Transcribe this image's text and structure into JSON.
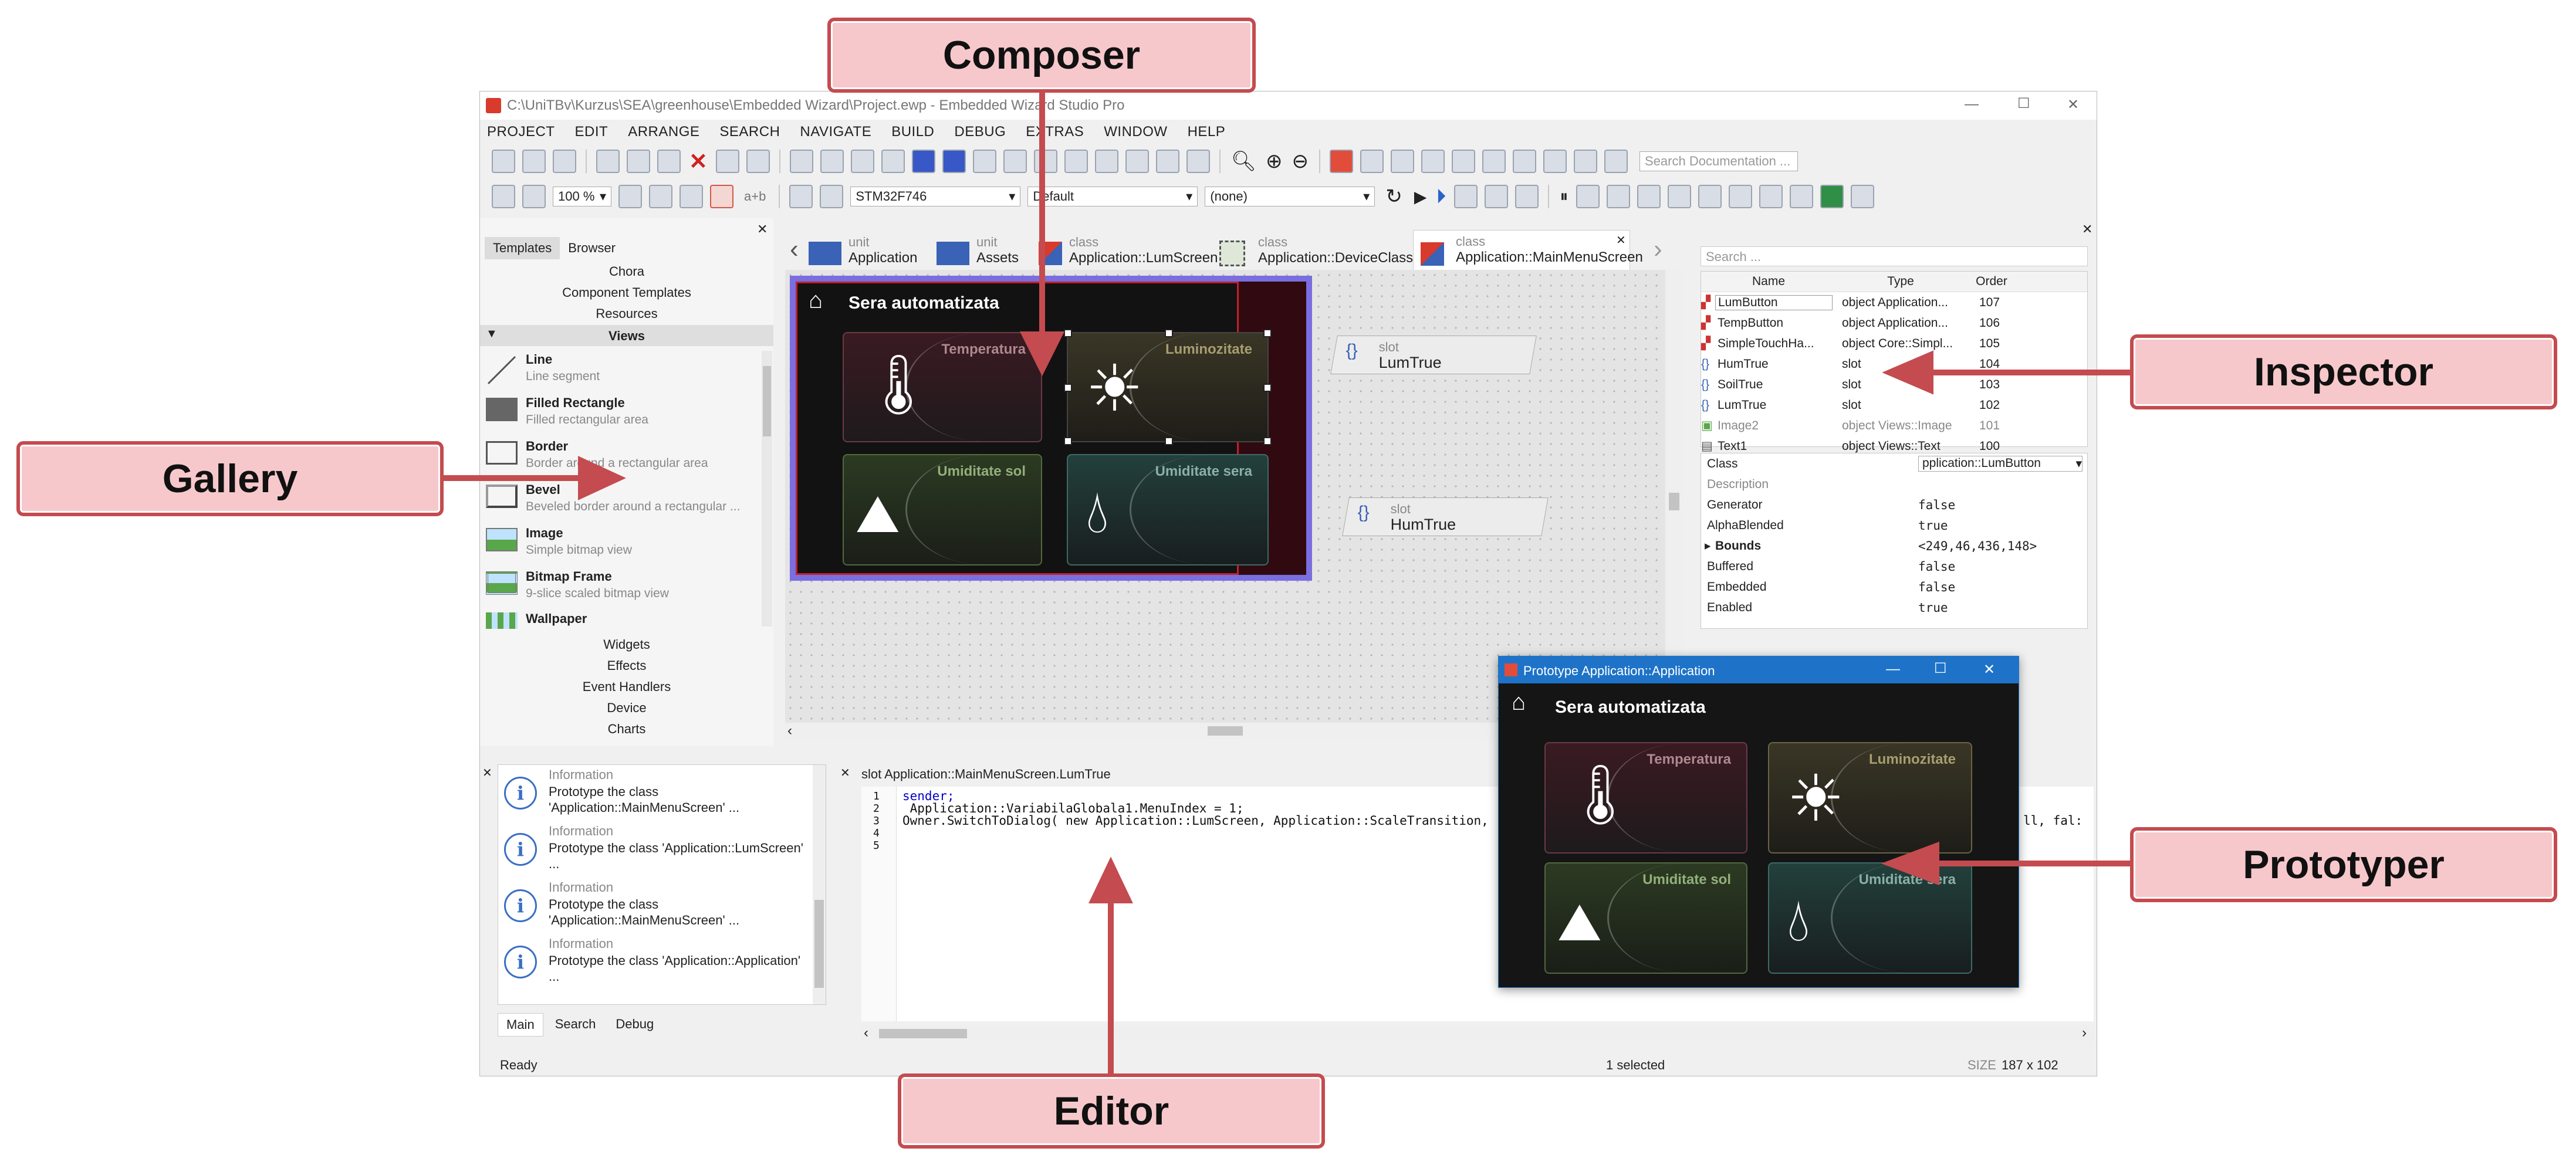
{
  "window": {
    "title": "C:\\UniTBv\\Kurzus\\SEA\\greenhouse\\Embedded Wizard\\Project.ewp - Embedded Wizard Studio Pro",
    "controls": {
      "min": "—",
      "max": "☐",
      "close": "✕"
    }
  },
  "menu": [
    "PROJECT",
    "EDIT",
    "ARRANGE",
    "SEARCH",
    "NAVIGATE",
    "BUILD",
    "DEBUG",
    "EXTRAS",
    "WINDOW",
    "HELP"
  ],
  "toolbar": {
    "search_placeholder": "Search Documentation ...",
    "zoom": "100 %",
    "ab_label": "a+b",
    "platform": "STM32F746",
    "profile": "Default",
    "variant": "(none)"
  },
  "browser_tabs": [
    {
      "kind": "unit",
      "name": "Application",
      "icon": "folder-icon"
    },
    {
      "kind": "unit",
      "name": "Assets",
      "icon": "folder-icon"
    },
    {
      "kind": "class",
      "name": "Application::LumScreen",
      "icon": "class-icon"
    },
    {
      "kind": "class",
      "name": "Application::DeviceClass",
      "icon": "device-class-icon"
    },
    {
      "kind": "class",
      "name": "Application::MainMenuScreen",
      "icon": "class-icon"
    }
  ],
  "gallery": {
    "tabs": [
      "Templates",
      "Browser"
    ],
    "folders_top": [
      "Chora",
      "Component Templates",
      "Resources"
    ],
    "open_folder": "Views",
    "items": [
      {
        "title": "Line",
        "desc": "Line segment",
        "icon": "line-icon"
      },
      {
        "title": "Filled Rectangle",
        "desc": "Filled rectangular area",
        "icon": "filled-rectangle-icon"
      },
      {
        "title": "Border",
        "desc": "Border around a rectangular area",
        "icon": "border-icon"
      },
      {
        "title": "Bevel",
        "desc": "Beveled border around a rectangular ...",
        "icon": "bevel-icon"
      },
      {
        "title": "Image",
        "desc": "Simple bitmap view",
        "icon": "image-icon"
      },
      {
        "title": "Bitmap Frame",
        "desc": "9-slice scaled bitmap view",
        "icon": "bitmap-frame-icon"
      },
      {
        "title": "Wallpaper",
        "desc": "",
        "icon": "wallpaper-icon"
      }
    ],
    "folders_bottom": [
      "Widgets",
      "Effects",
      "Event Handlers",
      "Device",
      "Charts"
    ]
  },
  "composer": {
    "screen_title": "Sera automatizata",
    "tiles": [
      "Temperatura",
      "Luminozitate",
      "Umiditate sol",
      "Umiditate sera"
    ],
    "slots": [
      {
        "kind": "slot",
        "name": "LumTrue"
      },
      {
        "kind": "slot",
        "name": "HumTrue"
      }
    ]
  },
  "inspector": {
    "search_placeholder": "Search ...",
    "columns": [
      "Name",
      "Type",
      "Order"
    ],
    "members": [
      {
        "name": "LumButton",
        "type": "object Application...",
        "order": "107"
      },
      {
        "name": "TempButton",
        "type": "object Application...",
        "order": "106"
      },
      {
        "name": "SimpleTouchHa...",
        "type": "object Core::Simpl...",
        "order": "105"
      },
      {
        "name": "HumTrue",
        "type": "slot",
        "order": "104"
      },
      {
        "name": "SoilTrue",
        "type": "slot",
        "order": "103"
      },
      {
        "name": "LumTrue",
        "type": "slot",
        "order": "102"
      },
      {
        "name": "Image2",
        "type": "object Views::Image",
        "order": "101"
      },
      {
        "name": "Text1",
        "type": "object Views::Text",
        "order": "100"
      }
    ],
    "properties": [
      {
        "name": "Class",
        "value": "pplication::LumButton"
      },
      {
        "name": "Description",
        "value": ""
      },
      {
        "name": "Generator",
        "value": "false"
      },
      {
        "name": "AlphaBlended",
        "value": "true"
      },
      {
        "name": "Bounds",
        "value": "<249,46,436,148>"
      },
      {
        "name": "Buffered",
        "value": "false"
      },
      {
        "name": "Embedded",
        "value": "false"
      },
      {
        "name": "Enabled",
        "value": "true"
      }
    ]
  },
  "log": {
    "entries": [
      {
        "type": "Information",
        "text": "Prototype the class 'Application::MainMenuScreen' ..."
      },
      {
        "type": "Information",
        "text": "Prototype the class 'Application::LumScreen' ..."
      },
      {
        "type": "Information",
        "text": "Prototype the class 'Application::MainMenuScreen' ..."
      },
      {
        "type": "Information",
        "text": "Prototype the class 'Application::Application' ..."
      }
    ],
    "tabs": [
      "Main",
      "Search",
      "Debug"
    ]
  },
  "editor": {
    "title": "slot Application::MainMenuScreen.LumTrue",
    "lines": [
      "sender;",
      " Application::VariabilaGlobala1.MenuIndex = 1;",
      "Owner.SwitchToDialog( new Application::LumScreen, Application::ScaleTransition,",
      "",
      ""
    ],
    "overflow_text": "ll, fal:"
  },
  "prototyper": {
    "title": "Prototype Application::Application",
    "screen_title": "Sera automatizata",
    "tiles": [
      "Temperatura",
      "Luminozitate",
      "Umiditate sol",
      "Umiditate sera"
    ]
  },
  "status": {
    "left": "Ready",
    "middle": "1 selected",
    "size_label": "SIZE",
    "size": "187 x 102"
  },
  "callouts": [
    "Composer",
    "Gallery",
    "Inspector",
    "Prototyper",
    "Editor"
  ],
  "colors": {
    "callout_fill": "#f7c8cb",
    "callout_border": "#c44b4f",
    "selection": "#7a6ee0",
    "prototyper_title": "#1e73c8"
  }
}
